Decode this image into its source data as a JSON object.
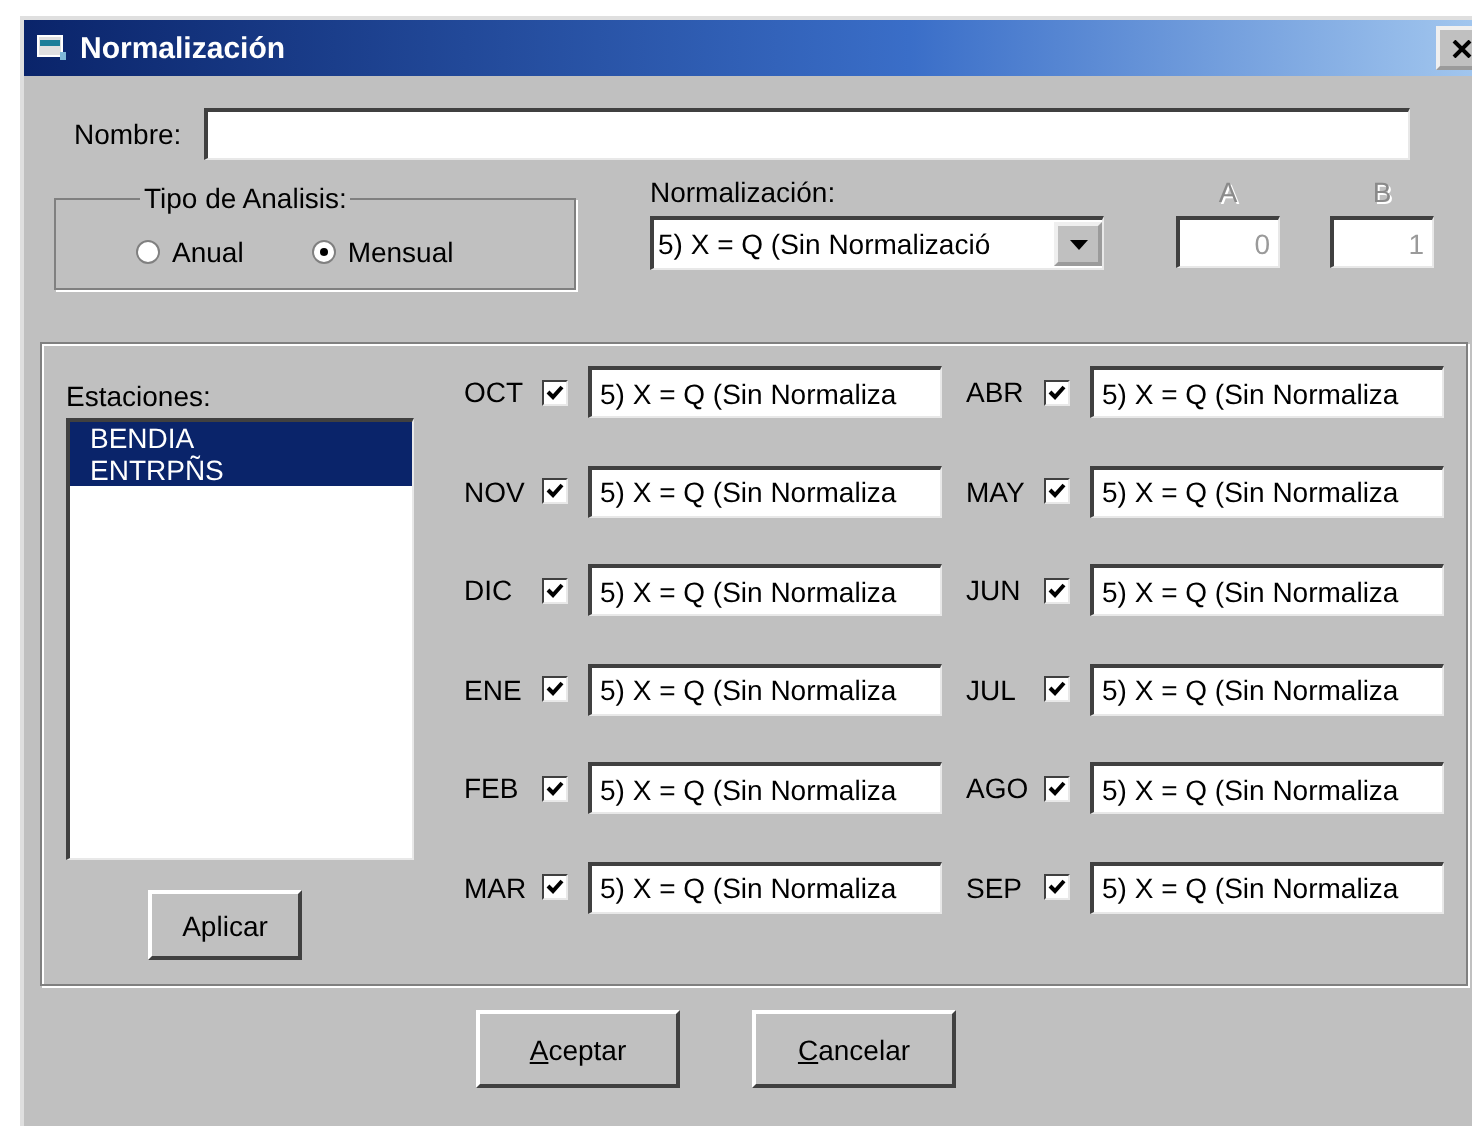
{
  "window": {
    "title": "Normalización"
  },
  "name_field": {
    "label": "Nombre:"
  },
  "analysis_type": {
    "title": "Tipo de Analisis:",
    "options": [
      {
        "label": "Anual",
        "selected": false
      },
      {
        "label": "Mensual",
        "selected": true
      }
    ]
  },
  "normalization": {
    "label": "Normalización:",
    "value": "5) X = Q (Sin Normalizació"
  },
  "params": [
    {
      "label": "A",
      "value": "0",
      "disabled": true
    },
    {
      "label": "B",
      "value": "1",
      "disabled": true
    }
  ],
  "stations": {
    "label": "Estaciones:",
    "items": [
      {
        "name": "BENDIA",
        "selected": true
      },
      {
        "name": "ENTRPÑS",
        "selected": true
      }
    ]
  },
  "apply_button": {
    "label": "Aplicar"
  },
  "months": [
    {
      "label": "OCT",
      "checked": true,
      "value": "5) X = Q (Sin Normaliza"
    },
    {
      "label": "NOV",
      "checked": true,
      "value": "5) X = Q (Sin Normaliza"
    },
    {
      "label": "DIC",
      "checked": true,
      "value": "5) X = Q (Sin Normaliza"
    },
    {
      "label": "ENE",
      "checked": true,
      "value": "5) X = Q (Sin Normaliza"
    },
    {
      "label": "FEB",
      "checked": true,
      "value": "5) X = Q (Sin Normaliza"
    },
    {
      "label": "MAR",
      "checked": true,
      "value": "5) X = Q (Sin Normaliza"
    },
    {
      "label": "ABR",
      "checked": true,
      "value": "5) X = Q (Sin Normaliza"
    },
    {
      "label": "MAY",
      "checked": true,
      "value": "5) X = Q (Sin Normaliza"
    },
    {
      "label": "JUN",
      "checked": true,
      "value": "5) X = Q (Sin Normaliza"
    },
    {
      "label": "JUL",
      "checked": true,
      "value": "5) X = Q (Sin Normaliza"
    },
    {
      "label": "AGO",
      "checked": true,
      "value": "5) X = Q (Sin Normaliza"
    },
    {
      "label": "SEP",
      "checked": true,
      "value": "5) X = Q (Sin Normaliza"
    }
  ],
  "buttons": [
    {
      "label": "Aceptar",
      "access_key_underlined": true
    },
    {
      "label": "Cancelar",
      "access_key_underlined": true
    }
  ]
}
